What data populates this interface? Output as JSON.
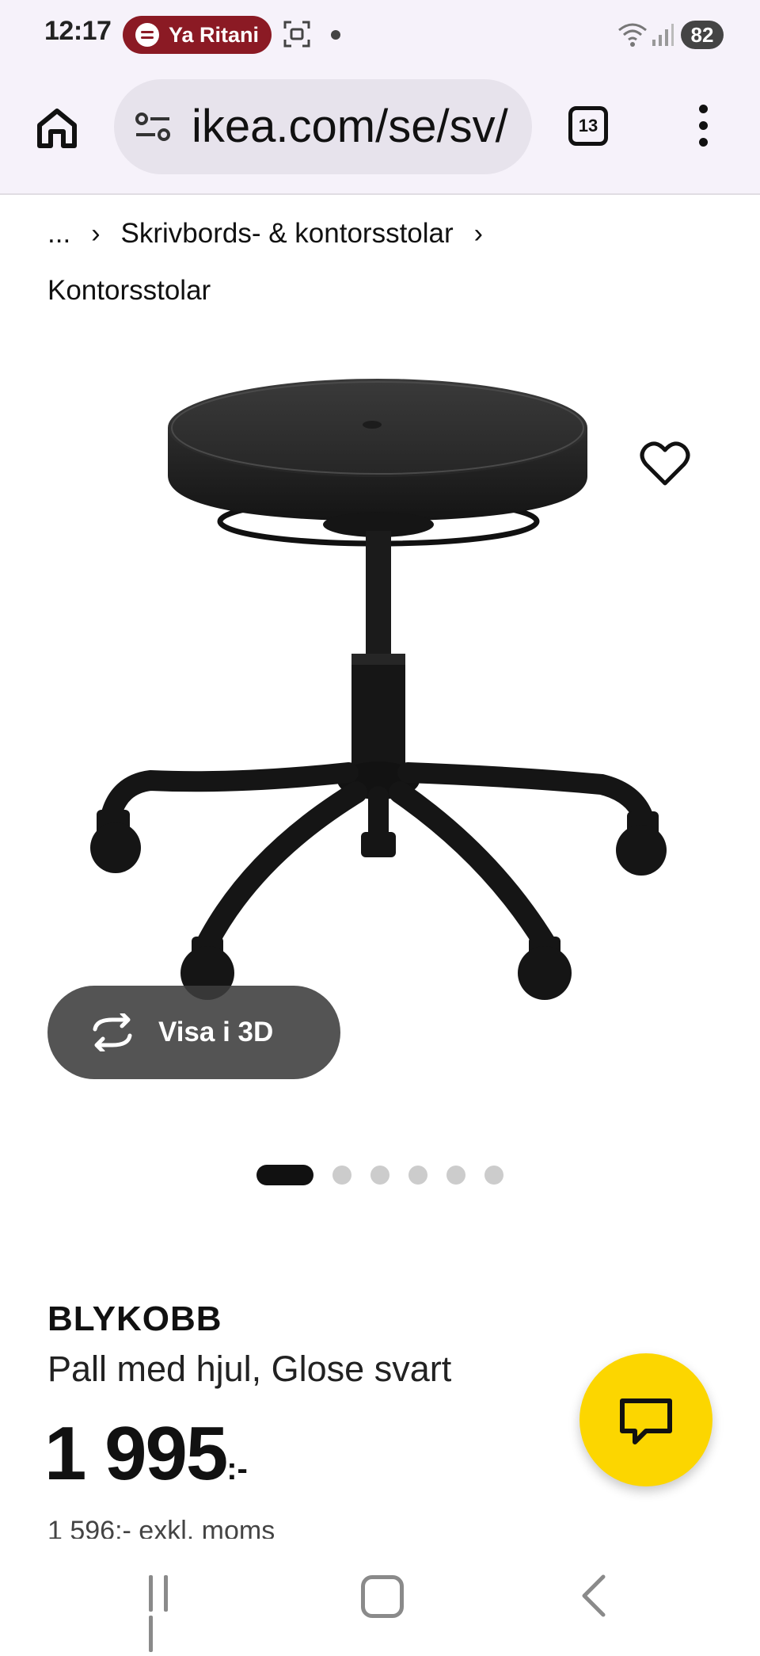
{
  "status_bar": {
    "time": "12:17",
    "media_pill": "Ya Ritani",
    "battery": "82"
  },
  "browser": {
    "url": "ikea.com/se/sv/",
    "tab_count": "13"
  },
  "breadcrumb": {
    "ellipsis": "...",
    "separator": "›",
    "items": [
      "Skrivbords- & kontorsstolar",
      "Kontorsstolar"
    ]
  },
  "gallery": {
    "view_3d_label": "Visa i 3D",
    "dot_count": 6,
    "active_dot": 0
  },
  "product": {
    "brand": "BLYKOBB",
    "description": "Pall med hjul, Glose svart",
    "price": "1 995",
    "price_suffix": ":-",
    "price_excl_vat": "1 596:- exkl. moms"
  },
  "colors": {
    "chat_button": "#fcd600",
    "media_pill": "#8b1a24"
  }
}
